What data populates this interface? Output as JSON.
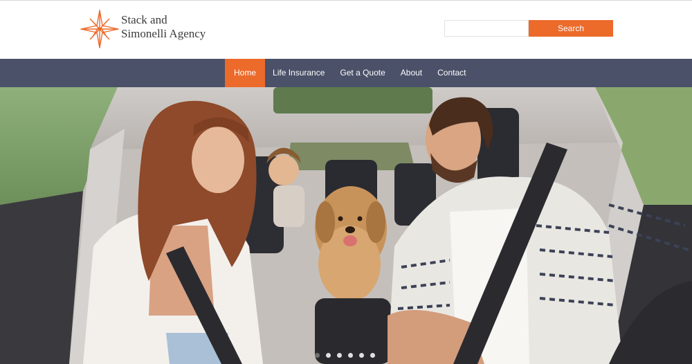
{
  "header": {
    "brand_line1": "Stack and",
    "brand_line2": "Simonelli Agency",
    "logo_icon": "compass-star-icon"
  },
  "search": {
    "placeholder": "",
    "value": "",
    "button_label": "Search"
  },
  "nav": {
    "items": [
      {
        "label": "Home",
        "active": true
      },
      {
        "label": "Life Insurance",
        "active": false
      },
      {
        "label": "Get a Quote",
        "active": false
      },
      {
        "label": "About",
        "active": false
      },
      {
        "label": "Contact",
        "active": false
      }
    ]
  },
  "hero": {
    "image": "family-with-dog-in-car-photo",
    "slide_count": 6,
    "active_slide": 1
  },
  "colors": {
    "accent": "#ec6a2a",
    "nav_background": "#4a5168",
    "brand_text": "#3a3a3a"
  }
}
